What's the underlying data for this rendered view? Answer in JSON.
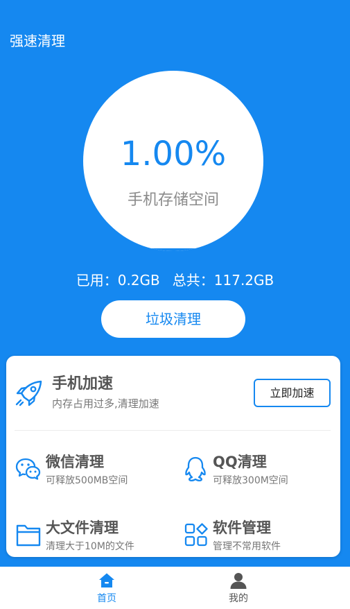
{
  "header": {
    "title": "强速清理"
  },
  "gauge": {
    "percent": "1.00%",
    "label": "手机存储空间",
    "used_fraction": 0.01
  },
  "storage": {
    "used": "已用：0.2GB",
    "total": "总共：117.2GB"
  },
  "clean_button": {
    "label": "垃圾清理"
  },
  "boost": {
    "title": "手机加速",
    "subtitle": "内存占用过多,清理加速",
    "button": "立即加速",
    "icon": "rocket-icon"
  },
  "features": [
    {
      "title": "微信清理",
      "subtitle": "可释放500MB空间",
      "icon": "wechat-icon"
    },
    {
      "title": "QQ清理",
      "subtitle": "可释放300M空间",
      "icon": "qq-icon"
    },
    {
      "title": "大文件清理",
      "subtitle": "清理大于10M的文件",
      "icon": "folder-icon"
    },
    {
      "title": "软件管理",
      "subtitle": "管理不常用软件",
      "icon": "apps-icon"
    }
  ],
  "nav": {
    "items": [
      {
        "label": "首页",
        "icon": "home-icon",
        "active": true
      },
      {
        "label": "我的",
        "icon": "person-icon",
        "active": false
      }
    ]
  },
  "colors": {
    "accent": "#1588f0",
    "text_dark": "#555555",
    "text_muted": "#777777",
    "nav_inactive": "#555555"
  }
}
